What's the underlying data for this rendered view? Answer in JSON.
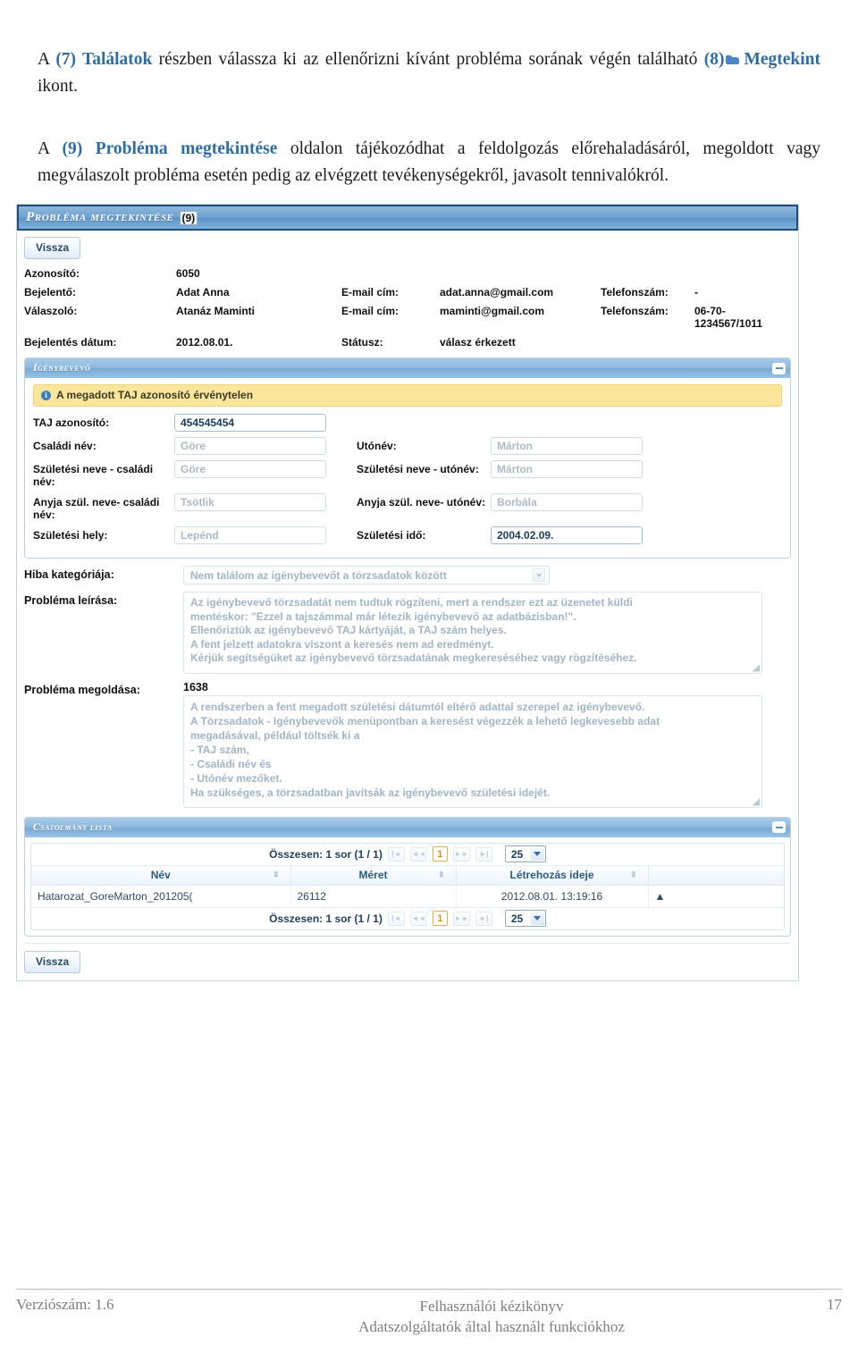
{
  "doc": {
    "para1": {
      "p1": "A ",
      "ref1": "(7) Találatok",
      "p2": " részben válassza ki az ellenőrizni kívánt probléma sorának végén található ",
      "ref2": "(8)",
      "icon": "folder-view-icon",
      "ref3": "Megtekint",
      "p3": " ikont."
    },
    "para2": {
      "p1": "A ",
      "ref1": "(9) Probléma megtekintése",
      "p2": " oldalon tájékozódhat a feldolgozás előrehaladásáról, megoldott vagy megválaszolt probléma esetén pedig az elvégzett tevékenységekről, javasolt tennivalókról."
    }
  },
  "screenshot": {
    "title": "Probléma megtekintése",
    "step_badge": "(9)",
    "back_button_top": "Vissza",
    "back_button_bottom": "Vissza",
    "header_fields": {
      "azonosito_label": "Azonosító:",
      "azonosito_value": "6050",
      "bejelento_label": "Bejelentő:",
      "bejelento_value": "Adat Anna",
      "bejelento_email_label": "E-mail cím:",
      "bejelento_email_value": "adat.anna@gmail.com",
      "bejelento_tel_label": "Telefonszám:",
      "bejelento_tel_value": "-",
      "valaszolo_label": "Válaszoló:",
      "valaszolo_value": "Atanáz Maminti",
      "valaszolo_email_label": "E-mail cím:",
      "valaszolo_email_value": "maminti@gmail.com",
      "valaszolo_tel_label": "Telefonszám:",
      "valaszolo_tel_value": "06-70-1234567/1011",
      "datum_label": "Bejelentés dátum:",
      "datum_value": "2012.08.01.",
      "statusz_label": "Státusz:",
      "statusz_value": "válasz érkezett"
    },
    "igenybevevo_panel": {
      "title": "Igénybevevő",
      "warning": "A megadott TAJ azonosító érvénytelen",
      "warning_icon": "info-icon",
      "collapse_icon": "minus-icon",
      "fields": [
        {
          "label": "TAJ azonosító:",
          "value": "454545454",
          "filled": true
        },
        {
          "label": "Családi név:",
          "value": "Göre",
          "filled": false
        },
        {
          "label": "Utónév:",
          "value": "Márton",
          "filled": false
        },
        {
          "label": "Születési neve - családi név:",
          "value": "Göre",
          "filled": false
        },
        {
          "label": "Születési neve - utónév:",
          "value": "Márton",
          "filled": false
        },
        {
          "label": "Anyja szül. neve- családi név:",
          "value": "Tsötlik",
          "filled": false
        },
        {
          "label": "Anyja szül. neve- utónév:",
          "value": "Borbála",
          "filled": false
        },
        {
          "label": "Születési hely:",
          "value": "Lepénd",
          "filled": false
        },
        {
          "label": "Születési idő:",
          "value": "2004.02.09.",
          "filled": true
        }
      ]
    },
    "hiba_kategoria": {
      "label": "Hiba kategóriája:",
      "value": "Nem találom az igénybevevőt a törzsadatok között",
      "caret_icon": "chevron-down-icon"
    },
    "problema_leirasa": {
      "label": "Probléma leírása:",
      "lines": [
        "Az igénybevevő törzsadatát nem tudtuk rögzíteni, mert a rendszer ezt az üzenetet küldi",
        "mentéskor: \"Ezzel a tajszámmal már létezik igénybevevő az adatbázisban!\".",
        "Ellenőriztük az igénybevevő TAJ kártyáját, a TAJ szám helyes.",
        "A fent jelzett adatokra viszont a keresés nem ad eredményt.",
        "Kérjük segítségüket az igénybevevő törzsadatának megkereséséhez vagy rögzítéséhez."
      ]
    },
    "problema_megoldasa": {
      "label": "Probléma megoldása:",
      "id": "1638",
      "lines": [
        "A rendszerben a fent megadott születési dátumtól eltérő adattal szerepel az igénybevevő.",
        "A Törzsadatok - Igénybevevők menüpontban a keresést végezzék a lehető legkevesebb adat",
        "megadásával, például töltsék ki a",
        "- TAJ szám,",
        "- Családi név és",
        "- Utónév mezőket.",
        "Ha szükséges, a törzsadatban javítsák az igénybevevő születési idejét."
      ]
    },
    "csatolmany_panel": {
      "title": "Csatolmány lista",
      "collapse_icon": "minus-icon",
      "pager": {
        "summary": "Összesen: 1 sor (1 / 1)",
        "first_icon": "|◄",
        "prev_icon": "◄◄",
        "page": "1",
        "next_icon": "►►",
        "last_icon": "►|",
        "page_size": "25"
      },
      "columns": [
        "Név",
        "Méret",
        "Létrehozás ideje"
      ],
      "sort_icon": "sort-arrows-icon",
      "rows": [
        {
          "nev": "Hatarozat_GoreMarton_201205(",
          "meret": "26112",
          "ido": "2012.08.01. 13:19:16",
          "action_icon": "▲"
        }
      ]
    }
  },
  "footer": {
    "version": "Verziószám: 1.6",
    "title_line1": "Felhasználói kézikönyv",
    "title_line2": "Adatszolgáltatók által használt funkciókhoz",
    "page": "17"
  }
}
